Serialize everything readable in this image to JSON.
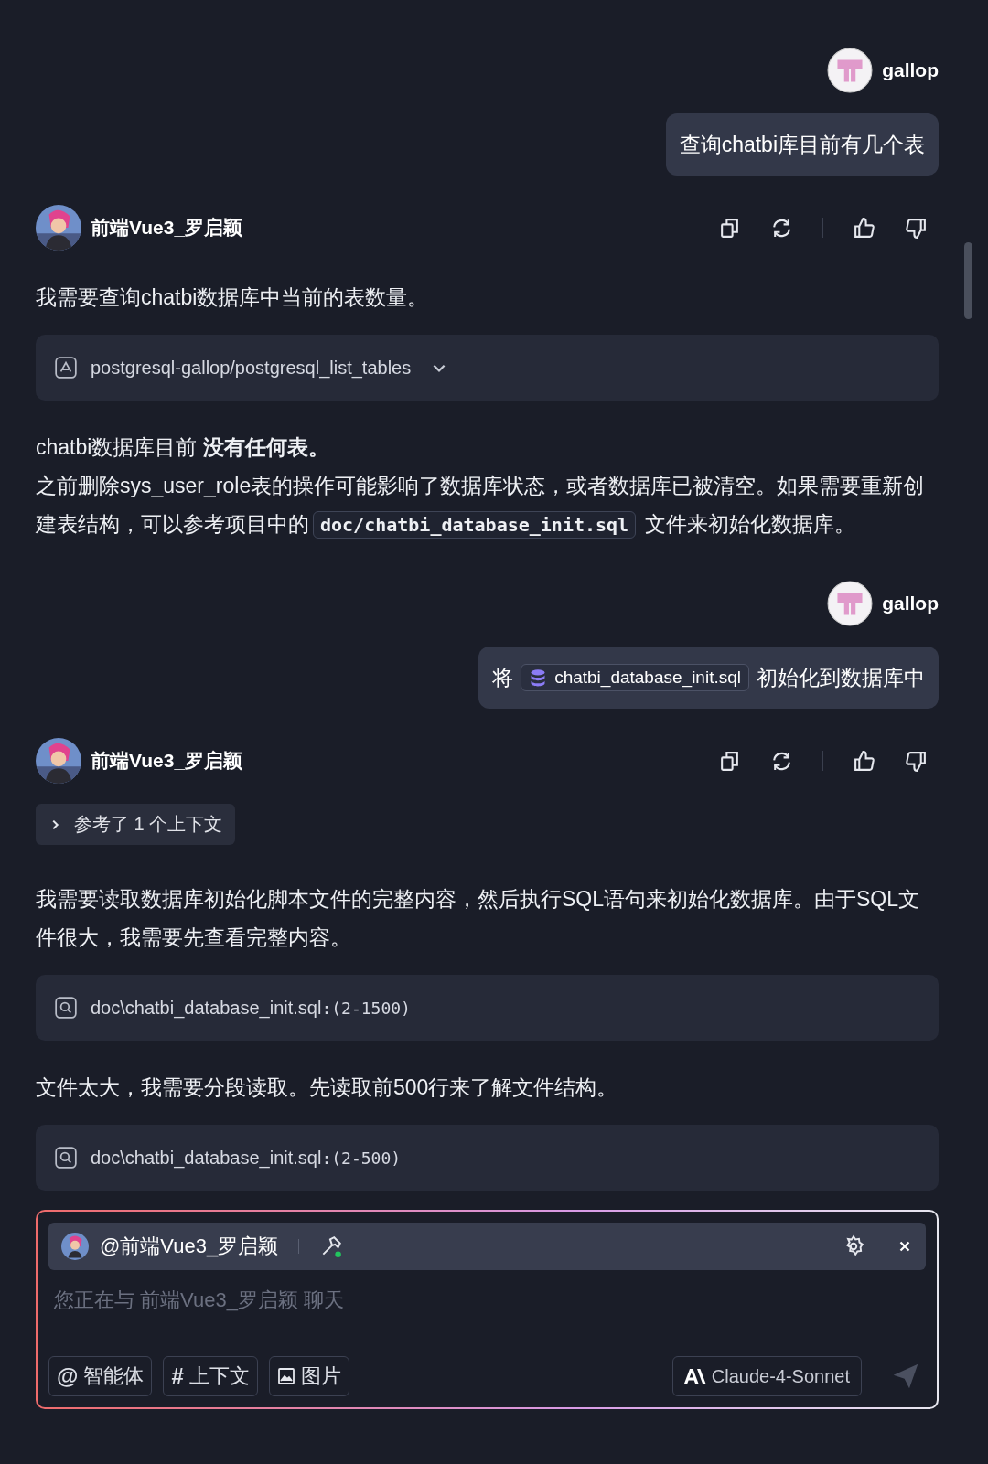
{
  "messages": [
    {
      "kind": "user",
      "name": "gallop",
      "segments": [
        {
          "kind": "text",
          "text": "查询chatbi库目前有几个表"
        }
      ]
    },
    {
      "kind": "assistant",
      "name": "前端Vue3_罗启颖",
      "blocks": [
        {
          "kind": "text",
          "segments": [
            {
              "kind": "text",
              "text": "我需要查询chatbi数据库中当前的表数量。"
            }
          ]
        },
        {
          "kind": "tool",
          "text": "postgresql-gallop/postgresql_list_tables"
        },
        {
          "kind": "text",
          "segments": [
            {
              "kind": "text",
              "text": "chatbi数据库目前 **没有任何表。**"
            }
          ]
        },
        {
          "kind": "text",
          "segments": [
            {
              "kind": "text",
              "text": "之前删除sys_user_role表的操作可能影响了数据库状态，或者数据库已被清空。如果需要重新创建表结构，可以参考项目中的"
            },
            {
              "kind": "code",
              "text": "doc/chatbi_database_init.sql"
            },
            {
              "kind": "text",
              "text": "文件来初始化数据库。"
            }
          ]
        }
      ]
    },
    {
      "kind": "user",
      "name": "gallop",
      "segments": [
        {
          "kind": "text",
          "text": "将"
        },
        {
          "kind": "file",
          "text": "chatbi_database_init.sql"
        },
        {
          "kind": "text",
          "text": "初始化到数据库中"
        }
      ]
    },
    {
      "kind": "assistant",
      "name": "前端Vue3_罗启颖",
      "blocks": [
        {
          "kind": "context",
          "text": "参考了 1 个上下文",
          "expanded": false
        },
        {
          "kind": "text",
          "segments": [
            {
              "kind": "text",
              "text": "我需要读取数据库初始化脚本文件的完整内容，然后执行SQL语句来初始化数据库。由于SQL文件很大，我需要先查看完整内容。"
            }
          ]
        },
        {
          "kind": "read",
          "text": "doc\\chatbi_database_init.sql",
          "range": ":(2-1500)"
        },
        {
          "kind": "text",
          "segments": [
            {
              "kind": "text",
              "text": "文件太大，我需要分段读取。先读取前500行来了解文件结构。"
            }
          ]
        },
        {
          "kind": "read",
          "text": "doc\\chatbi_database_init.sql",
          "range": ":(2-500)"
        }
      ]
    }
  ],
  "composer": {
    "agent": "@前端Vue3_罗启颖",
    "placeholder": "您正在与 前端Vue3_罗启颖 聊天",
    "buttons": [
      {
        "kind": "glyph",
        "icon": "@",
        "label": "智能体"
      },
      {
        "kind": "glyph",
        "icon": "#",
        "label": "上下文"
      },
      {
        "kind": "image",
        "label": "图片"
      }
    ],
    "model": "Claude-4-Sonnet",
    "send_disabled": true
  }
}
